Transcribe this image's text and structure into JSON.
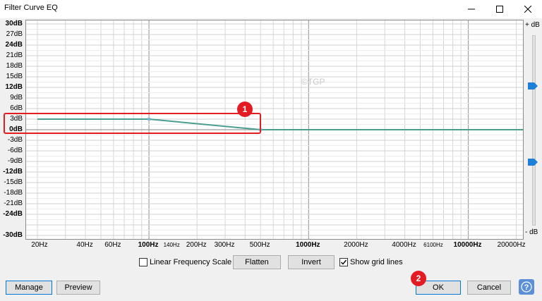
{
  "window": {
    "title": "Filter Curve EQ"
  },
  "y_axis": {
    "labels": [
      {
        "text": "30dB",
        "db": 30,
        "bold": true
      },
      {
        "text": "27dB",
        "db": 27,
        "bold": false
      },
      {
        "text": "24dB",
        "db": 24,
        "bold": true
      },
      {
        "text": "21dB",
        "db": 21,
        "bold": false
      },
      {
        "text": "18dB",
        "db": 18,
        "bold": false
      },
      {
        "text": "15dB",
        "db": 15,
        "bold": false
      },
      {
        "text": "12dB",
        "db": 12,
        "bold": true
      },
      {
        "text": "9dB",
        "db": 9,
        "bold": false
      },
      {
        "text": "6dB",
        "db": 6,
        "bold": false
      },
      {
        "text": "3dB",
        "db": 3,
        "bold": false
      },
      {
        "text": "0dB",
        "db": 0,
        "bold": true
      },
      {
        "text": "-3dB",
        "db": -3,
        "bold": false
      },
      {
        "text": "-6dB",
        "db": -6,
        "bold": false
      },
      {
        "text": "-9dB",
        "db": -9,
        "bold": false
      },
      {
        "text": "-12dB",
        "db": -12,
        "bold": true
      },
      {
        "text": "-15dB",
        "db": -15,
        "bold": false
      },
      {
        "text": "-18dB",
        "db": -18,
        "bold": false
      },
      {
        "text": "-21dB",
        "db": -21,
        "bold": false
      },
      {
        "text": "-24dB",
        "db": -24,
        "bold": true
      },
      {
        "text": "-30dB",
        "db": -30,
        "bold": true
      }
    ]
  },
  "x_axis": {
    "labels": [
      {
        "text": "20Hz",
        "hz": 20,
        "bold": false,
        "small": false
      },
      {
        "text": "40Hz",
        "hz": 40,
        "bold": false,
        "small": false
      },
      {
        "text": "60Hz",
        "hz": 60,
        "bold": false,
        "small": false
      },
      {
        "text": "100Hz",
        "hz": 100,
        "bold": true,
        "small": false
      },
      {
        "text": "140Hz",
        "hz": 140,
        "bold": false,
        "small": true
      },
      {
        "text": "200Hz",
        "hz": 200,
        "bold": false,
        "small": false
      },
      {
        "text": "300Hz",
        "hz": 300,
        "bold": false,
        "small": false
      },
      {
        "text": "500Hz",
        "hz": 500,
        "bold": false,
        "small": false
      },
      {
        "text": "1000Hz",
        "hz": 1000,
        "bold": true,
        "small": false
      },
      {
        "text": "2000Hz",
        "hz": 2000,
        "bold": false,
        "small": false
      },
      {
        "text": "4000Hz",
        "hz": 4000,
        "bold": false,
        "small": false
      },
      {
        "text": "6100Hz",
        "hz": 6100,
        "bold": false,
        "small": true
      },
      {
        "text": "10000Hz",
        "hz": 10000,
        "bold": true,
        "small": false
      },
      {
        "text": "20000Hz",
        "hz": 20000,
        "bold": false,
        "small": false
      }
    ]
  },
  "chart_data": {
    "type": "line",
    "x_scale": "log",
    "xlim": [
      17,
      22000
    ],
    "ylim": [
      -31,
      31
    ],
    "grid": true,
    "series": [
      {
        "points": [
          {
            "x": 20,
            "y": 3
          },
          {
            "x": 100,
            "y": 3
          },
          {
            "x": 500,
            "y": 0
          },
          {
            "x": 22000,
            "y": 0
          }
        ]
      }
    ],
    "curve_color": "#4a9e8f",
    "highlight_color": "#e31b23"
  },
  "side_slider": {
    "top_label": "+ dB",
    "bottom_label": "- dB",
    "thumb_color": "#1e7fd8",
    "thumbs": [
      0.27,
      0.67
    ]
  },
  "watermark": "©TGP",
  "controls": {
    "linear_frequency_label": "Linear Frequency Scale",
    "linear_frequency_checked": false,
    "flatten_label": "Flatten",
    "invert_label": "Invert",
    "show_grid_label": "Show grid lines",
    "show_grid_checked": true
  },
  "buttons": {
    "manage": "Manage",
    "preview": "Preview",
    "ok": "OK",
    "cancel": "Cancel"
  },
  "annotations": {
    "badge1": "1",
    "badge2": "2"
  }
}
